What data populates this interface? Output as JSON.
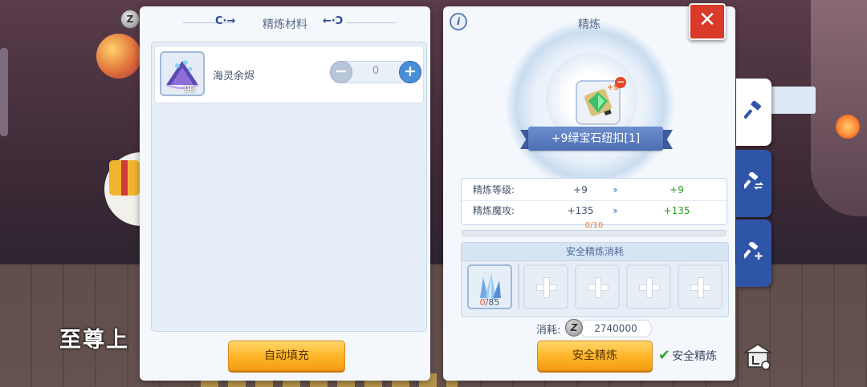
{
  "background": {
    "banner_text": "至尊上"
  },
  "materials_panel": {
    "title": "精炼材料",
    "items": [
      {
        "name": "海灵余烬",
        "count": "90",
        "quantity": "0",
        "icon": "sea-spirit-ember-icon"
      }
    ],
    "auto_fill_label": "自动填充"
  },
  "refine_panel": {
    "title": "精炼",
    "info_icon": "i",
    "close_icon": "✕",
    "equipment": {
      "name": "+9绿宝石纽扣[1]",
      "refine_badge": "+9",
      "icon": "green-gem-button-icon"
    },
    "stats": [
      {
        "label": "精炼等级:",
        "current": "+9",
        "next": "+9"
      },
      {
        "label": "精炼魔攻:",
        "current": "+135",
        "next": "+135"
      }
    ],
    "progress": {
      "label": "0/10",
      "value": 0,
      "max": 10
    },
    "safe_cost": {
      "header": "安全精炼消耗",
      "crystal": {
        "owned": "0",
        "required": "85",
        "icon": "blue-crystal-icon"
      },
      "empty_slots": 4
    },
    "consume": {
      "label": "消耗:",
      "currency_icon": "zeny-coin-icon",
      "value": "2740000"
    },
    "safe_refine_label": "安全精炼",
    "safe_checkbox_label": "安全精炼",
    "safe_checked": true
  },
  "side_tabs": [
    {
      "name": "refine",
      "icon": "hammer-icon",
      "active": true
    },
    {
      "name": "transfer",
      "icon": "hammer-transfer-icon",
      "active": false
    },
    {
      "name": "enhance",
      "icon": "hammer-plus-icon",
      "active": false
    }
  ],
  "colors": {
    "accent_orange": "#ffb426",
    "tab_blue": "#2f55a8",
    "close_red": "#d93a2a",
    "increase_green": "#2aa02a"
  }
}
